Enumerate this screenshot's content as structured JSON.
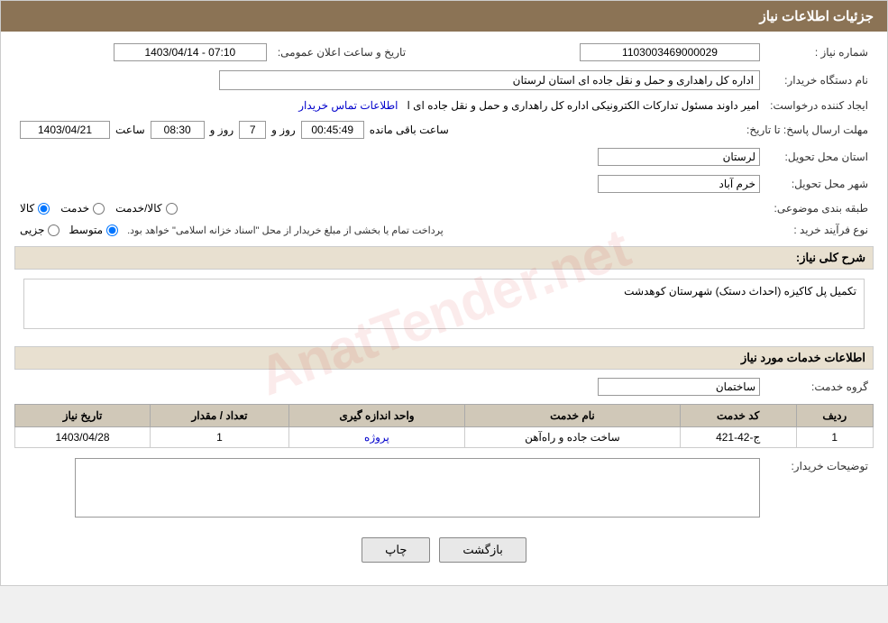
{
  "header": {
    "title": "جزئیات اطلاعات نیاز"
  },
  "fields": {
    "need_number_label": "شماره نیاز :",
    "need_number_value": "1103003469000029",
    "buyer_org_label": "نام دستگاه خریدار:",
    "buyer_org_value": "اداره کل راهداری و حمل و نقل جاده ای استان لرستان",
    "creator_label": "ایجاد کننده درخواست:",
    "creator_value": "امیر داوند مسئول تدارکات الکترونیکی  اداره کل راهداری و حمل و نقل جاده ای ا",
    "creator_link": "اطلاعات تماس خریدار",
    "announce_date_label": "تاریخ و ساعت اعلان عمومی:",
    "announce_date_value": "1403/04/14 - 07:10",
    "reply_deadline_label": "مهلت ارسال پاسخ: تا تاریخ:",
    "reply_date": "1403/04/21",
    "reply_time": "08:30",
    "reply_days": "7",
    "reply_remaining": "00:45:49",
    "reply_days_label": "روز و",
    "reply_remaining_label": "ساعت باقی مانده",
    "delivery_province_label": "استان محل تحویل:",
    "delivery_province_value": "لرستان",
    "delivery_city_label": "شهر محل تحویل:",
    "delivery_city_value": "خرم آباد",
    "category_label": "طبقه بندی موضوعی:",
    "category_options": [
      "کالا",
      "خدمت",
      "کالا/خدمت"
    ],
    "category_selected": "کالا",
    "purchase_type_label": "نوع فرآیند خرید :",
    "purchase_types": [
      "جزیی",
      "متوسط"
    ],
    "purchase_type_note": "پرداخت تمام یا بخشی از مبلغ خریدار از محل \"اسناد خزانه اسلامی\" خواهد بود.",
    "description_label": "شرح کلی نیاز:",
    "description_value": "تکمیل پل کاکیزه (احداث دستک) شهرستان کوهدشت",
    "services_info_label": "اطلاعات خدمات مورد نیاز",
    "service_group_label": "گروه خدمت:",
    "service_group_value": "ساختمان",
    "table_headers": {
      "row_num": "ردیف",
      "service_code": "کد خدمت",
      "service_name": "نام خدمت",
      "unit": "واحد اندازه گیری",
      "quantity": "تعداد / مقدار",
      "need_date": "تاریخ نیاز"
    },
    "table_rows": [
      {
        "row_num": "1",
        "service_code": "ج-42-421",
        "service_name": "ساخت جاده و راه‌آهن",
        "unit": "پروژه",
        "quantity": "1",
        "need_date": "1403/04/28"
      }
    ],
    "buyer_notes_label": "توضیحات خریدار:",
    "buyer_notes_value": ""
  },
  "buttons": {
    "print": "چاپ",
    "back": "بازگشت"
  }
}
